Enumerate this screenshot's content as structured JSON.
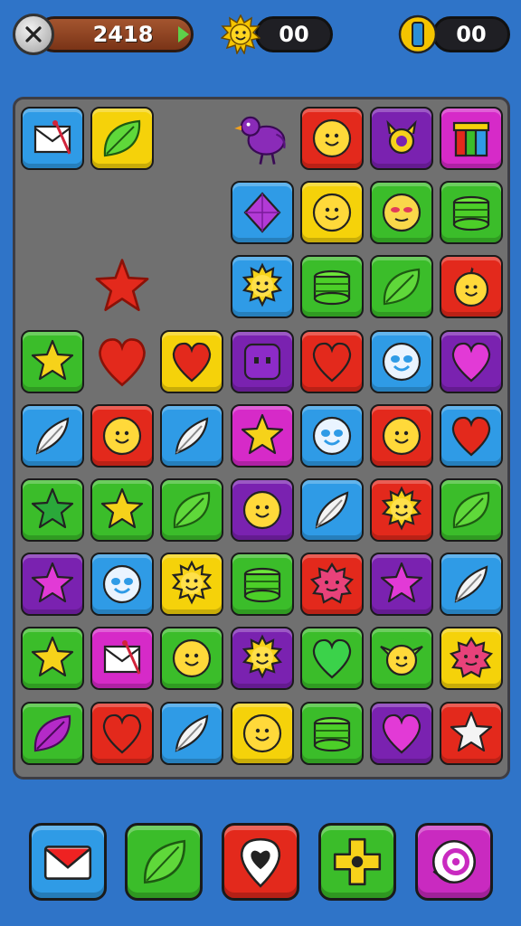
{
  "hud": {
    "score": "2418",
    "suns": "00",
    "coins": "00"
  },
  "colors": {
    "blue": "#2f9be6",
    "yellow": "#f5d20a",
    "red": "#e3291c",
    "purple": "#7a22b0",
    "magenta": "#d62ac8",
    "green": "#3bbd2a",
    "board": "#707070",
    "background": "#2f74c8"
  },
  "board": {
    "rows": [
      [
        "envelope-tile-blue",
        "leaf-tile-yellow",
        "empty",
        "purple-bird",
        "smiley-tile-red",
        "crown-tile-purple",
        "gift-tile-magenta"
      ],
      [
        "empty",
        "empty",
        "empty",
        "diamond-tile-blue",
        "smiley-tile-yellow",
        "cheeky-face-tile-green",
        "coin-stack-tile-green"
      ],
      [
        "empty",
        "loose-red-star",
        "empty",
        "sun-tile-blue",
        "coin-stack-tile-green",
        "leaf-tile-green",
        "bomb-face-tile-red"
      ],
      [
        "star-tile-green",
        "loose-red-heart",
        "heart-tile-yellow",
        "block-face-tile-purple",
        "heart-tile-red",
        "round-face-tile-blue",
        "heart-tile-purple"
      ],
      [
        "feather-tile-blue",
        "smiley-tile-red",
        "feather-tile-blue",
        "star-tile-magenta",
        "round-face-tile-blue",
        "smiley-tile-red",
        "heart-tile-blue"
      ],
      [
        "star-tile-green-dark",
        "star-tile-green",
        "leaf-tile-green",
        "smiley-tile-purple",
        "feather-tile-blue",
        "sun-tile-red",
        "leaf-tile-green"
      ],
      [
        "star-tile-purple",
        "round-face-tile-blue",
        "sun-tile-yellow",
        "coin-stack-tile-green",
        "flower-tile-red",
        "star-tile-purple",
        "feather-tile-blue"
      ],
      [
        "star-tile-green",
        "envelope-tile-magenta",
        "smiley-tile-green",
        "sun-tile-purple",
        "heart-tile-green",
        "goblin-face-tile-green",
        "flower-tile-yellow"
      ],
      [
        "leaf-tile-green",
        "heart-tile-red",
        "feather-tile-blue",
        "smiley-tile-yellow",
        "coin-stack-tile-green",
        "heart-tile-purple",
        "star-tile-red"
      ]
    ]
  },
  "boosters": [
    {
      "name": "mail-booster",
      "icon": "envelope-icon"
    },
    {
      "name": "leaf-booster",
      "icon": "leaf-icon"
    },
    {
      "name": "heart-pin-booster",
      "icon": "heart-pin-icon"
    },
    {
      "name": "cross-booster",
      "icon": "cross-icon"
    },
    {
      "name": "swirl-booster",
      "icon": "swirl-icon"
    }
  ]
}
